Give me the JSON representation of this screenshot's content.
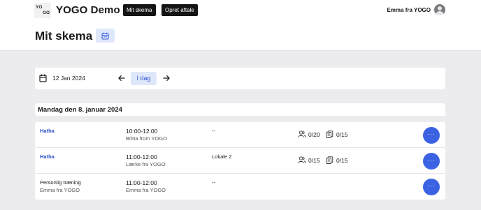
{
  "header": {
    "logo_line1": "YO",
    "logo_line2": "GO",
    "brand": "YOGO Demo",
    "nav": [
      "Mit skema",
      "Opret aftale"
    ],
    "user_name": "Emma fra YOGO"
  },
  "page": {
    "title": "Mit skema"
  },
  "date_nav": {
    "date": "12 Jan 2024",
    "today_label": "I dag"
  },
  "day": {
    "heading": "Mandag den 8. januar 2024"
  },
  "classes": [
    {
      "name": "Hatha",
      "sub": "",
      "time": "10:00-12:00",
      "teacher": "Britta from YOGO",
      "room": "--",
      "signups": "0/20",
      "waitlist": "0/15",
      "more": "···"
    },
    {
      "name": "Hatha",
      "sub": "",
      "time": "11:00-12:00",
      "teacher": "Lærke fra YOGO",
      "room": "Lokale 2",
      "signups": "0/15",
      "waitlist": "0/15",
      "more": "···"
    },
    {
      "name": "Personlig træning",
      "sub": "Emma fra YOGO",
      "time": "11:00-12:00",
      "teacher": "Emma fra YOGO",
      "room": "--",
      "signups": "",
      "waitlist": "",
      "more": "···"
    }
  ],
  "colors": {
    "accent": "#3b62e3",
    "accent_light": "#dfe7fb",
    "link": "#2a4fc9",
    "background": "#ececef"
  }
}
